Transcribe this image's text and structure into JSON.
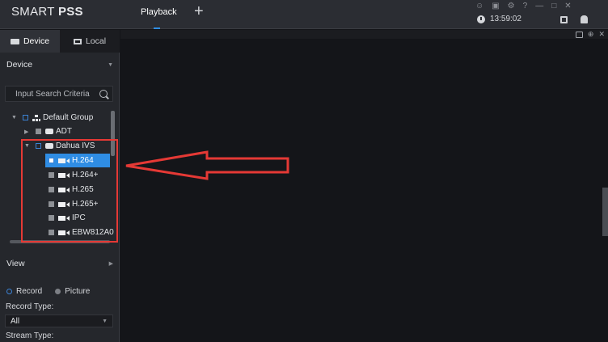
{
  "app": {
    "title_light": "SMART ",
    "title_bold": "PSS"
  },
  "tabs": [
    {
      "label": "Playback"
    }
  ],
  "add_tab": "+",
  "titlebar": {
    "icons": [
      "user-icon",
      "lock-icon",
      "settings-icon",
      "help-icon",
      "minimize-icon",
      "maximize-icon",
      "close-icon"
    ],
    "time": "13:59:02"
  },
  "sidebar": {
    "tabs": [
      {
        "label": "Device"
      },
      {
        "label": "Local"
      }
    ],
    "device_section": "Device",
    "search": {
      "placeholder": "Input Search Criteria"
    },
    "tree": {
      "group": "Default Group",
      "devices": [
        {
          "label": "ADT"
        },
        {
          "label": "Dahua IVS"
        }
      ],
      "channels": [
        {
          "label": "H.264",
          "selected": true
        },
        {
          "label": "H.264+"
        },
        {
          "label": "H.265"
        },
        {
          "label": "H.265+"
        },
        {
          "label": "IPC"
        },
        {
          "label": "EBW812A0"
        }
      ]
    },
    "view_section": "View",
    "mode": {
      "record": "Record",
      "picture": "Picture",
      "selected": "Record"
    },
    "record_type_label": "Record Type:",
    "record_type_value": "All",
    "stream_type_label": "Stream Type:"
  },
  "colors": {
    "accent": "#2f8de4",
    "annotation": "#e53935",
    "background": "#141519"
  }
}
